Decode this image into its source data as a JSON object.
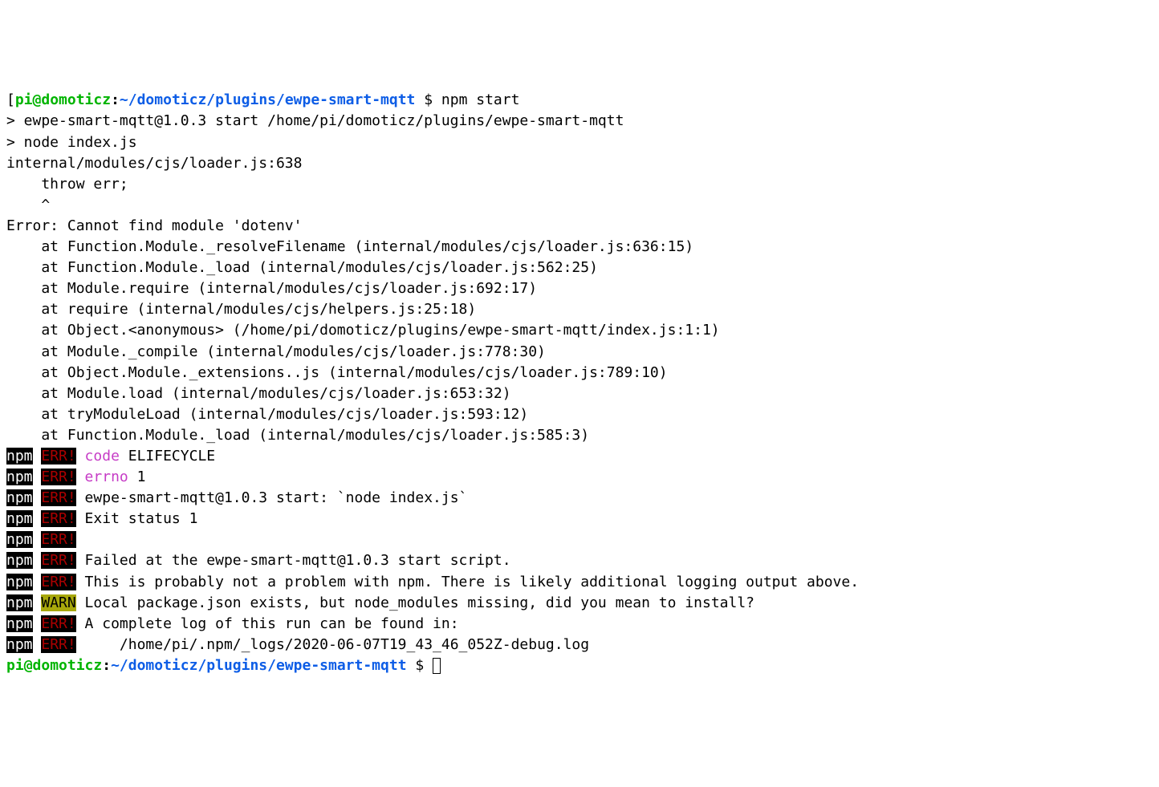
{
  "prompt1": {
    "bracket": "[",
    "user": "pi",
    "at": "@",
    "host": "domoticz",
    "colon": ":",
    "path": "~/domoticz/plugins/ewpe-smart-mqtt",
    "dollar": " $ ",
    "cmd": "npm start"
  },
  "blank": " ",
  "out": {
    "l0": "",
    "l1": "> ewpe-smart-mqtt@1.0.3 start /home/pi/domoticz/plugins/ewpe-smart-mqtt",
    "l2": "> node index.js",
    "l3": "",
    "l4": "internal/modules/cjs/loader.js:638",
    "l5": "    throw err;",
    "l6": "    ^",
    "l7": "",
    "l8": "Error: Cannot find module 'dotenv'",
    "l9": "    at Function.Module._resolveFilename (internal/modules/cjs/loader.js:636:15)",
    "l10": "    at Function.Module._load (internal/modules/cjs/loader.js:562:25)",
    "l11": "    at Module.require (internal/modules/cjs/loader.js:692:17)",
    "l12": "    at require (internal/modules/cjs/helpers.js:25:18)",
    "l13": "    at Object.<anonymous> (/home/pi/domoticz/plugins/ewpe-smart-mqtt/index.js:1:1)",
    "l14": "    at Module._compile (internal/modules/cjs/loader.js:778:30)",
    "l15": "    at Object.Module._extensions..js (internal/modules/cjs/loader.js:789:10)",
    "l16": "    at Module.load (internal/modules/cjs/loader.js:653:32)",
    "l17": "    at tryModuleLoad (internal/modules/cjs/loader.js:593:12)",
    "l18": "    at Function.Module._load (internal/modules/cjs/loader.js:585:3)"
  },
  "badges": {
    "npm": "npm",
    "err": "ERR!",
    "warn": "WARN",
    "gap": " "
  },
  "errlines": {
    "e1_key": " code",
    "e1_val": " ELIFECYCLE",
    "e2_key": " errno",
    "e2_val": " 1",
    "e3": " ewpe-smart-mqtt@1.0.3 start: `node index.js`",
    "e4": " Exit status 1",
    "e5": " ",
    "e6": " Failed at the ewpe-smart-mqtt@1.0.3 start script.",
    "e7": " This is probably not a problem with npm. There is likely additional logging output above.",
    "warn1": " Local package.json exists, but node_modules missing, did you mean to install?",
    "blank": "",
    "e8": " A complete log of this run can be found in:",
    "e9": "     /home/pi/.npm/_logs/2020-06-07T19_43_46_052Z-debug.log"
  },
  "prompt2": {
    "user": "pi",
    "at": "@",
    "host": "domoticz",
    "colon": ":",
    "path": "~/domoticz/plugins/ewpe-smart-mqtt",
    "dollar": " $ "
  }
}
